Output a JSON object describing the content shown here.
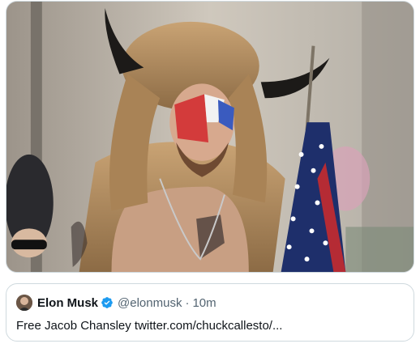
{
  "media": {
    "icon": "photo-image"
  },
  "quoted_tweet": {
    "author_name": "Elon Musk",
    "handle": "@elonmusk",
    "separator": "·",
    "time": "10m",
    "text": "Free Jacob Chansley twitter.com/chuckcallesto/...",
    "verified_icon": "verified-badge-icon",
    "verified_color": "#1d9bf0"
  }
}
